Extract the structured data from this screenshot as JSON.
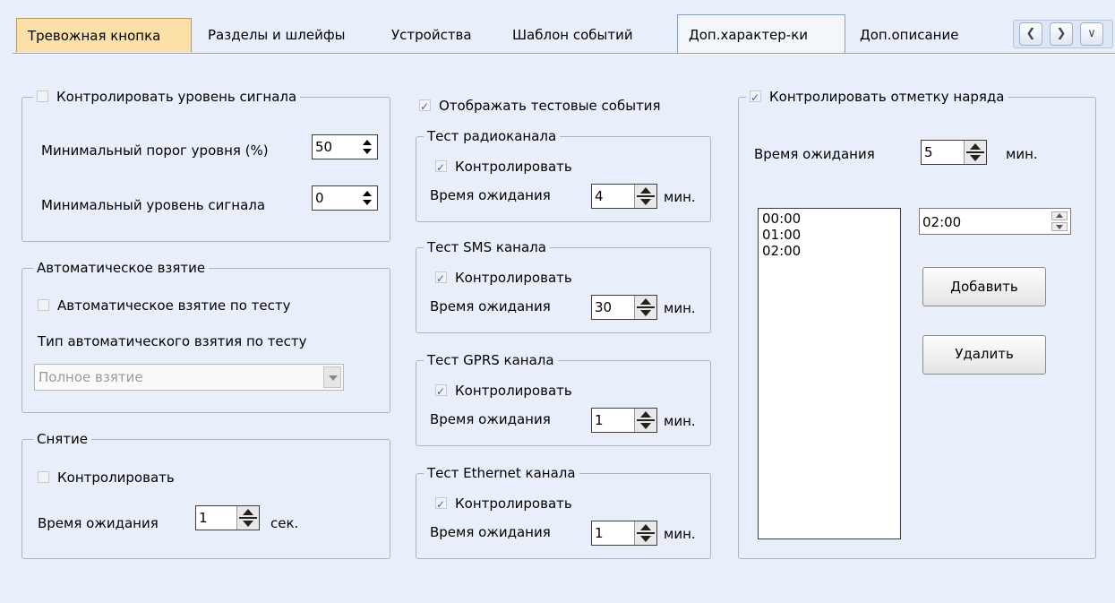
{
  "tabs": [
    {
      "label": "Тревожная кнопка"
    },
    {
      "label": "Разделы и шлейфы"
    },
    {
      "label": "Устройства"
    },
    {
      "label": "Шаблон событий"
    },
    {
      "label": "Доп.характер-ки"
    },
    {
      "label": "Доп.описание"
    }
  ],
  "nav_icons": [
    "scroll-left-icon",
    "scroll-right-icon",
    "dropdown-list-icon"
  ],
  "signal": {
    "legend": "Контролировать уровень сигнала",
    "checked": false,
    "min_threshold_label": "Минимальный порог уровня (%)",
    "min_threshold_value": "50",
    "min_level_label": "Минимальный уровень сигнала",
    "min_level_value": "0"
  },
  "auto_arm": {
    "legend": "Автоматическое взятие",
    "by_test_label": "Автоматическое взятие по тесту",
    "by_test_checked": false,
    "type_label": "Тип автоматического взятия по тесту",
    "type_value": "Полное взятие"
  },
  "disarm": {
    "legend": "Снятие",
    "control_label": "Контролировать",
    "control_checked": false,
    "wait_label": "Время ожидания",
    "wait_value": "1",
    "unit": "сек."
  },
  "show_test_events": {
    "label": "Отображать тестовые события",
    "checked": true
  },
  "tests": [
    {
      "legend": "Тест радиоканала",
      "control_label": "Контролировать",
      "checked": true,
      "wait_label": "Время ожидания",
      "wait_value": "4",
      "unit": "мин."
    },
    {
      "legend": "Тест SMS канала",
      "control_label": "Контролировать",
      "checked": true,
      "wait_label": "Время ожидания",
      "wait_value": "30",
      "unit": "мин."
    },
    {
      "legend": "Тест GPRS канала",
      "control_label": "Контролировать",
      "checked": true,
      "wait_label": "Время ожидания",
      "wait_value": "1",
      "unit": "мин."
    },
    {
      "legend": "Тест Ethernet канала",
      "control_label": "Контролировать",
      "checked": true,
      "wait_label": "Время ожидания",
      "wait_value": "1",
      "unit": "мин."
    }
  ],
  "duty": {
    "legend": "Контролировать отметку наряда",
    "checked": true,
    "wait_label": "Время ожидания",
    "wait_value": "5",
    "unit": "мин.",
    "times": [
      "00:00",
      "01:00",
      "02:00"
    ],
    "time_input": "02:00",
    "add_label": "Добавить",
    "delete_label": "Удалить"
  },
  "colors": {
    "background": "#e9effa",
    "first_tab": "#fbe0a7",
    "check_accent": "#3a5fc7"
  }
}
